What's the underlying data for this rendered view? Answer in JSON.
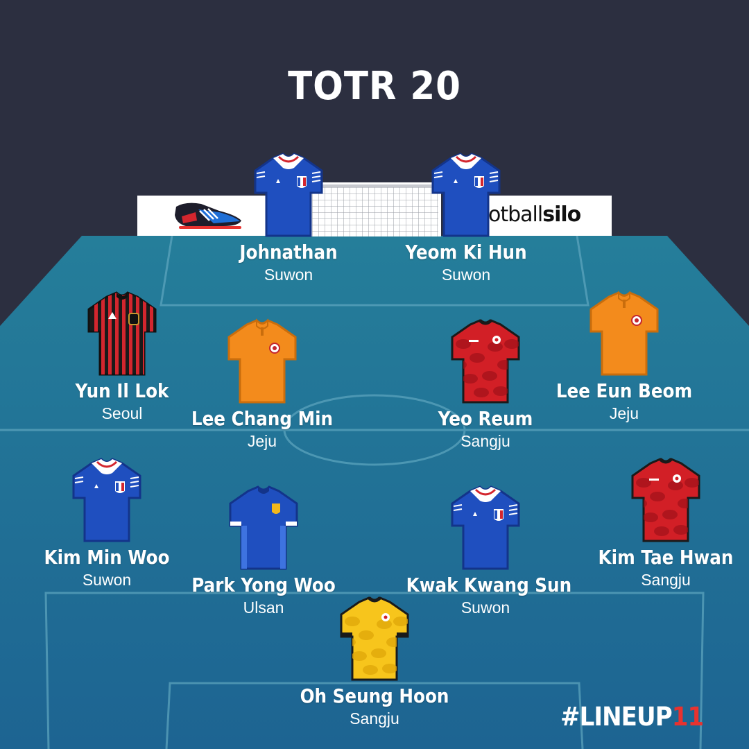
{
  "title": "TOTR 20",
  "hashtag": {
    "main": "#LINEUP",
    "accent": "11"
  },
  "sponsor": {
    "text_light": "otball",
    "text_bold": "silo",
    "boot_icon": "football-boot-icon"
  },
  "colors": {
    "background": "#2c2f40",
    "pitch_top": "#257e9a",
    "pitch_bottom": "#1d6492",
    "hashtag_accent": "#e8322f"
  },
  "players": [
    {
      "id": "johnathan",
      "name": "Johnathan",
      "club": "Suwon",
      "kit": "suwon"
    },
    {
      "id": "yeom-ki-hun",
      "name": "Yeom Ki Hun",
      "club": "Suwon",
      "kit": "suwon"
    },
    {
      "id": "yun-il-lok",
      "name": "Yun Il Lok",
      "club": "Seoul",
      "kit": "seoul"
    },
    {
      "id": "lee-chang-min",
      "name": "Lee Chang Min",
      "club": "Jeju",
      "kit": "jeju"
    },
    {
      "id": "yeo-reum",
      "name": "Yeo Reum",
      "club": "Sangju",
      "kit": "sangju"
    },
    {
      "id": "lee-eun-beom",
      "name": "Lee Eun Beom",
      "club": "Jeju",
      "kit": "jeju"
    },
    {
      "id": "kim-min-woo",
      "name": "Kim Min Woo",
      "club": "Suwon",
      "kit": "suwon"
    },
    {
      "id": "park-yong-woo",
      "name": "Park Yong Woo",
      "club": "Ulsan",
      "kit": "ulsan"
    },
    {
      "id": "kwak-kwang-sun",
      "name": "Kwak Kwang Sun",
      "club": "Suwon",
      "kit": "suwon"
    },
    {
      "id": "kim-tae-hwan",
      "name": "Kim Tae Hwan",
      "club": "Sangju",
      "kit": "sangju"
    },
    {
      "id": "oh-seung-hoon",
      "name": "Oh Seung Hoon",
      "club": "Sangju",
      "kit": "sangju-gk"
    }
  ]
}
